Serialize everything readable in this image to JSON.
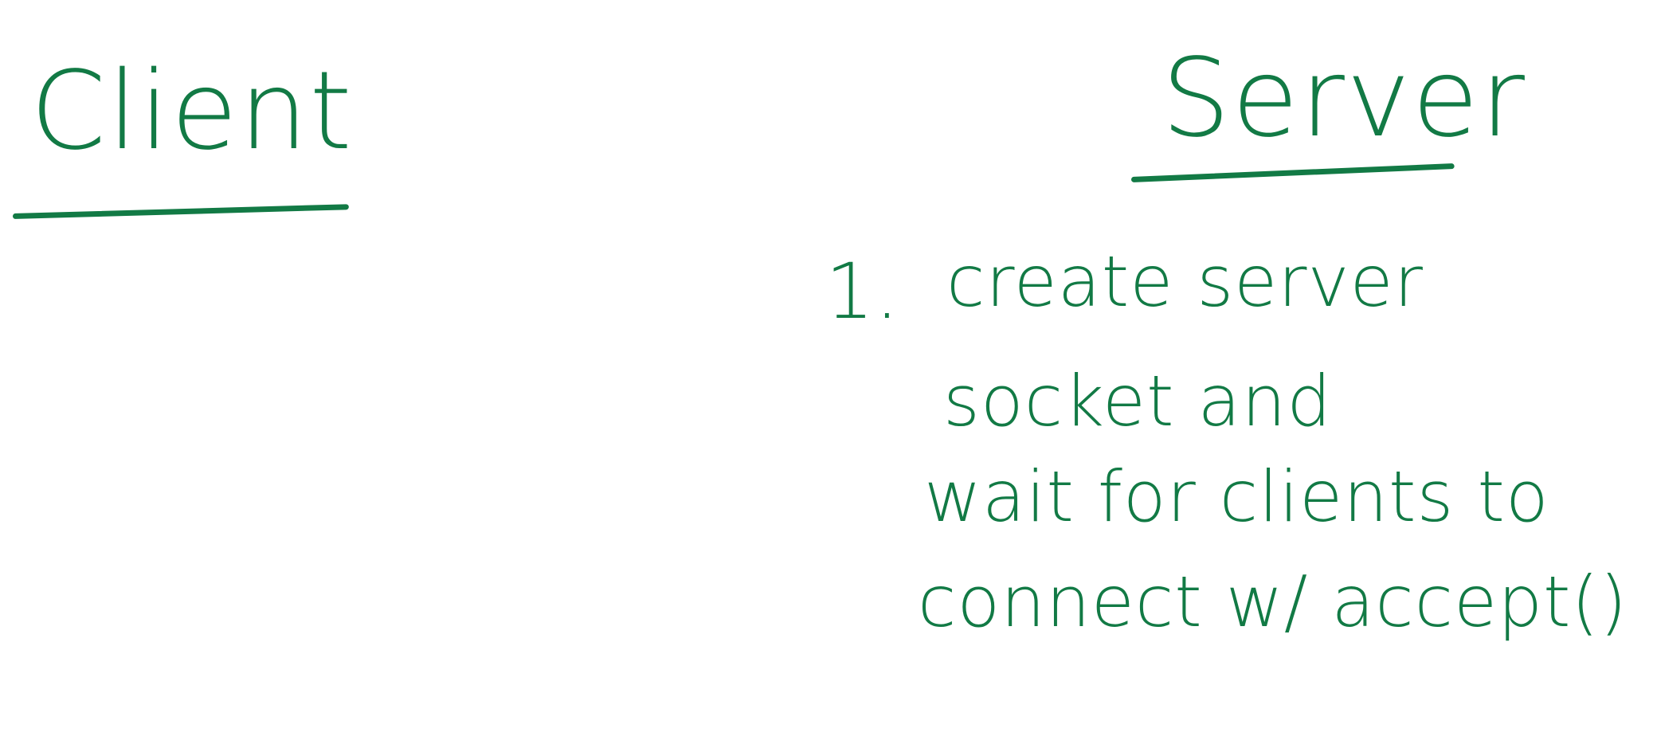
{
  "whiteboard": {
    "ink_color": "#127a45",
    "client": {
      "heading": "Client"
    },
    "server": {
      "heading": "Server",
      "steps": [
        {
          "number": "1.",
          "lines": [
            "create server",
            "socket and",
            "wait for clients to",
            "connect w/ accept()"
          ]
        }
      ]
    }
  }
}
